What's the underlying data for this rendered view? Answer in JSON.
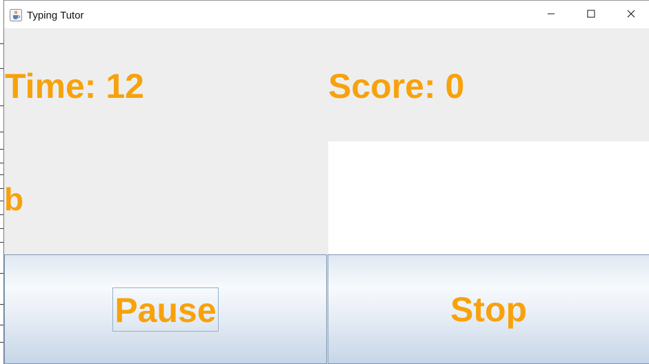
{
  "window": {
    "title": "Typing Tutor"
  },
  "stats": {
    "time_label": "Time: 12",
    "score_label": "Score: 0"
  },
  "current_word": "b",
  "buttons": {
    "pause_label": "Pause",
    "stop_label": "Stop"
  },
  "colors": {
    "accent": "#f7a20c",
    "panel_bg": "#eeeeee",
    "button_border": "#7f96ae"
  },
  "icons": {
    "app": "java-cup-icon",
    "minimize": "minimize-icon",
    "maximize": "maximize-icon",
    "close": "close-icon"
  }
}
